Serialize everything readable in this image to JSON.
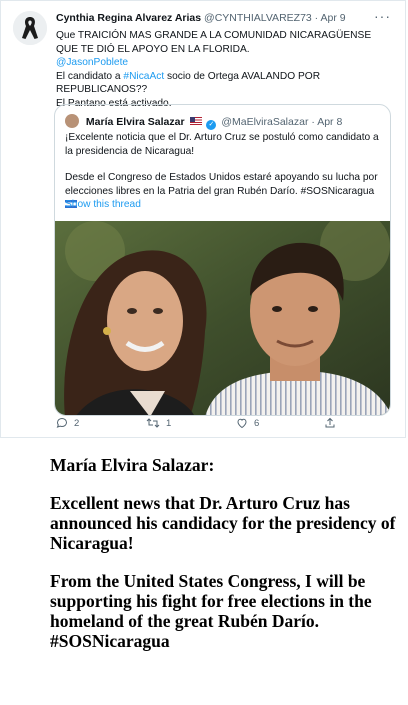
{
  "tweet": {
    "author_name": "Cynthia Regina Alvarez Arias",
    "author_handle": "@CYNTHIALVAREZ73",
    "separator": "·",
    "date": "Apr 9",
    "line1": "Que TRAICIÓN MAS GRANDE A LA COMUNIDAD NICARAGÜENSE QUE TE DIÓ EL APOYO EN LA FLORIDA.",
    "mention": "@JasonPoblete",
    "line3_pre": "El candidato a ",
    "hashtag": "#NicaAct",
    "line3_post": " socio de Ortega AVALANDO POR REPUBLICANOS??",
    "line4": "El Pantano está activado.",
    "more_icon": "···"
  },
  "quote": {
    "author_name": "María Elvira Salazar",
    "author_handle": "@MaElviraSalazar",
    "separator": "·",
    "date": "Apr 8",
    "para1": "¡Excelente noticia que el Dr. Arturo Cruz se postuló como candidato a la presidencia de Nicaragua!",
    "para2": "Desde el Congreso de Estados Unidos estaré apoyando su lucha por elecciones libres en la Patria del gran Rubén Darío. #SOSNicaragua",
    "show_thread": "Show this thread",
    "verified_glyph": "✓"
  },
  "actions": {
    "reply_count": "2",
    "retweet_count": "1",
    "like_count": "6"
  },
  "translation": {
    "speaker": "María Elvira Salazar:",
    "para1": "Excellent news that Dr. Arturo Cruz has announced his candidacy for the presidency of Nicaragua!",
    "para2": "From the United States Congress, I will be supporting his fight for free elections in the homeland of the great Rubén Darío. #SOSNicaragua"
  }
}
